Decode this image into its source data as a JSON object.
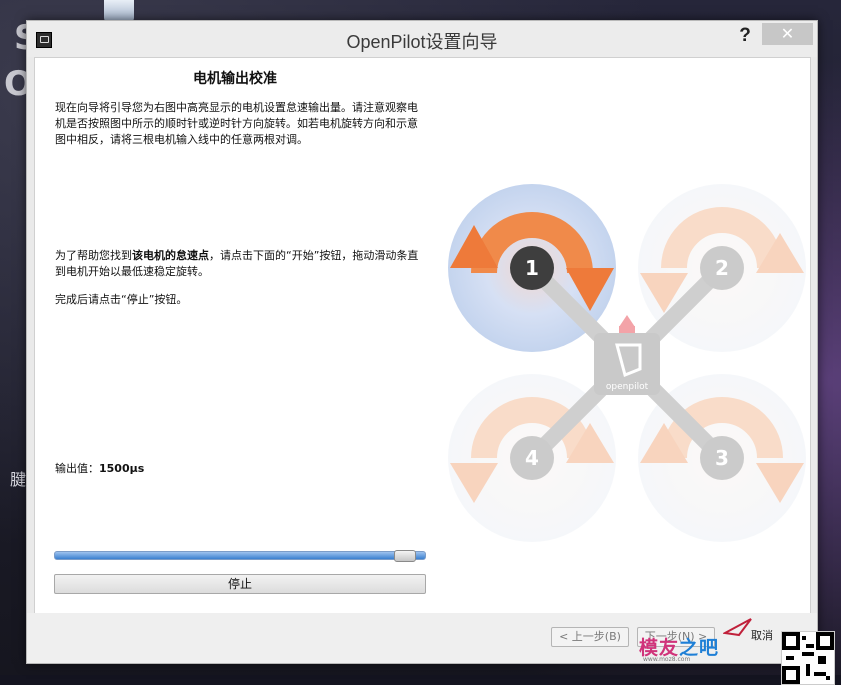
{
  "window": {
    "title": "OpenPilot设置向导",
    "help_label": "?",
    "close_label": "✕"
  },
  "page": {
    "title": "电机输出校准",
    "para1": "现在向导将引导您为右图中高亮显示的电机设置怠速输出量。请注意观察电机是否按照图中所示的顺时针或逆时针方向旋转。如若电机旋转方向和示意图中相反，请将三根电机输入线中的任意两根对调。",
    "para2_before": "为了帮助您找到",
    "para2_bold": "该电机的怠速点",
    "para2_after": "，请点击下面的“开始”按钮，拖动滑动条直到电机开始以最低速稳定旋转。",
    "para3": "完成后请点击“停止”按钮。",
    "output_label": "输出值：",
    "output_value": "1500µs",
    "slider_fraction": 0.97,
    "stop_label": "停止"
  },
  "diagram": {
    "logo_text": "openpilot",
    "motors": [
      {
        "number": "1",
        "active": true
      },
      {
        "number": "2",
        "active": false
      },
      {
        "number": "3",
        "active": false
      },
      {
        "number": "4",
        "active": false
      }
    ],
    "colors": {
      "active_disc": "#c8d8f0",
      "rotor_arrow": "#f07a30",
      "frame": "#cfcfcf",
      "active_hub": "#3e3e3e",
      "forward_arrow": "#f0a0a8"
    }
  },
  "footer": {
    "back_label": "< 上一步(B)",
    "next_label": "下一步(N) >",
    "cancel_label": "取消"
  },
  "watermark": {
    "text1": "模友",
    "text2": "之吧",
    "url": "www.moz8.com"
  },
  "desktop": {
    "letter1": "S",
    "letter2": "O",
    "side_char": "腱"
  }
}
